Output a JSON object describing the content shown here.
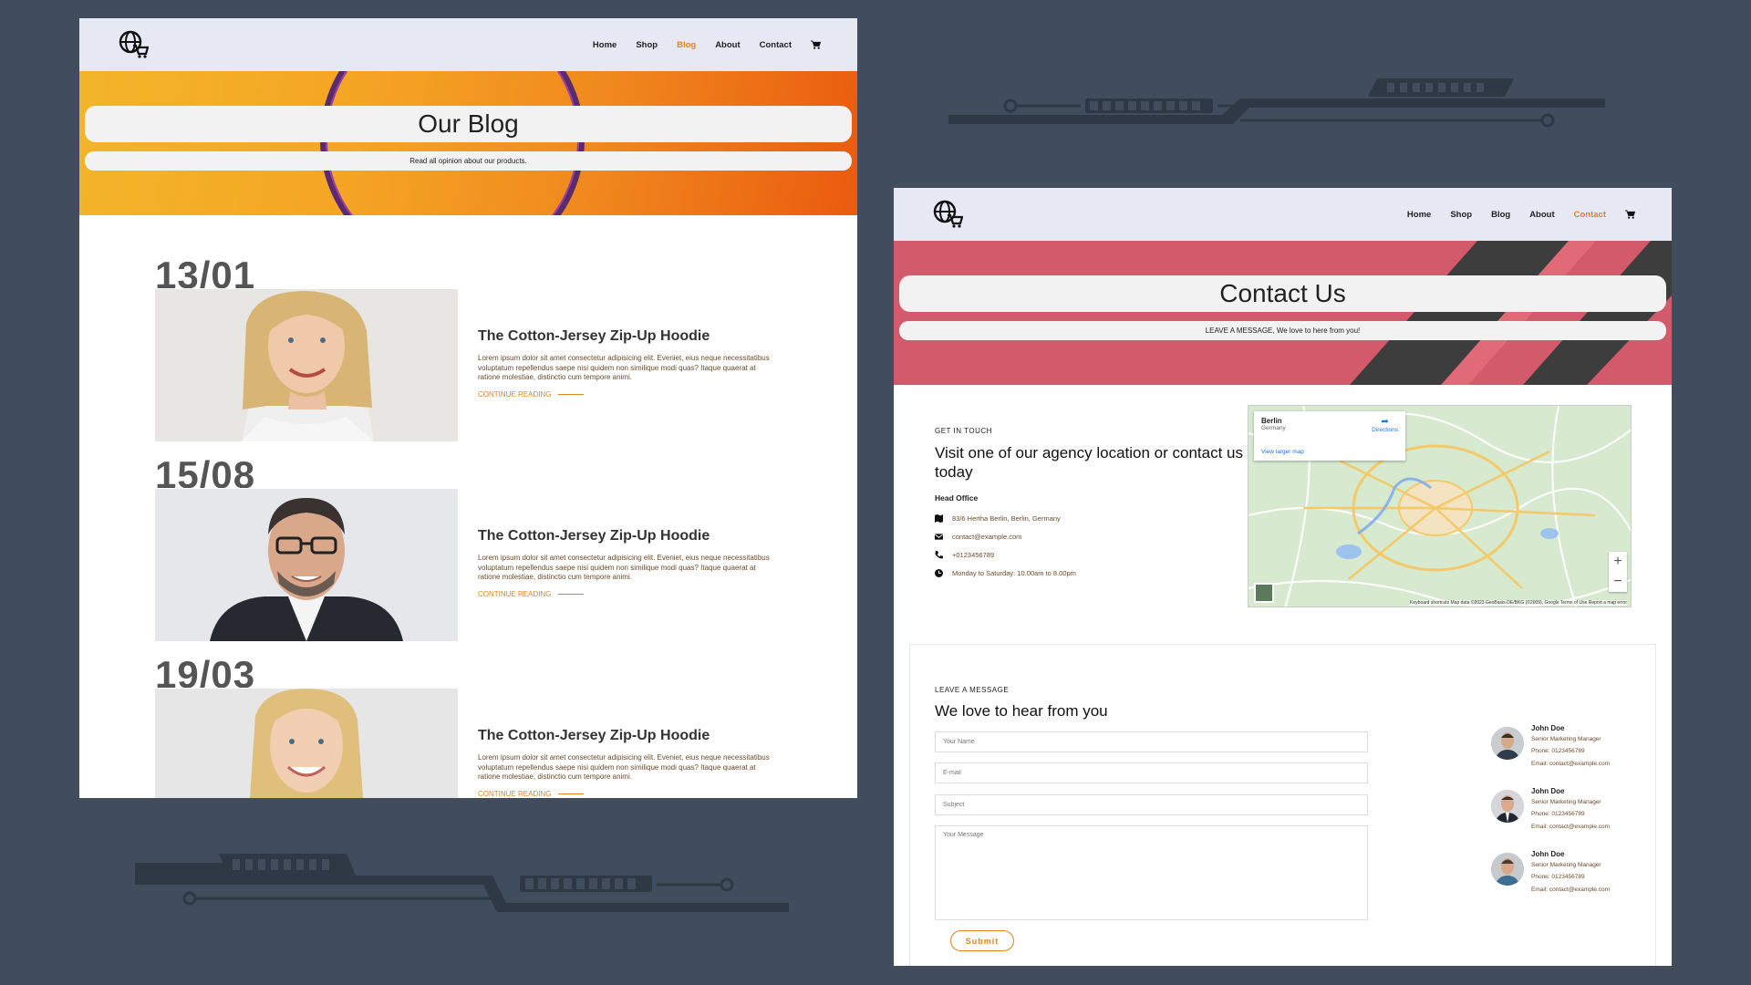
{
  "blog_page": {
    "nav": [
      "Home",
      "Shop",
      "Blog",
      "About",
      "Contact"
    ],
    "active_nav": "Blog",
    "hero_title": "Our Blog",
    "hero_subtitle": "Read all opinion about our products.",
    "posts": [
      {
        "date": "13/01",
        "title": "The Cotton-Jersey Zip-Up Hoodie",
        "text": "Lorem ipsum dolor sit amet consectetur adipisicing elit. Eveniet, eius neque necessitatibus voluptatum repellendus saepe nisi quidem non similique modi quas? Itaque quaerat at ratione molestiae, distinctio cum tempore animi.",
        "link": "CONTINUE READING"
      },
      {
        "date": "15/08",
        "title": "The Cotton-Jersey Zip-Up Hoodie",
        "text": "Lorem ipsum dolor sit amet consectetur adipisicing elit. Eveniet, eius neque necessitatibus voluptatum repellendus saepe nisi quidem non similique modi quas? Itaque quaerat at ratione molestiae, distinctio cum tempore animi.",
        "link": "CONTINUE READING"
      },
      {
        "date": "19/03",
        "title": "The Cotton-Jersey Zip-Up Hoodie",
        "text": "Lorem ipsum dolor sit amet consectetur adipisicing elit. Eveniet, eius neque necessitatibus voluptatum repellendus saepe nisi quidem non similique modi quas? Itaque quaerat at ratione molestiae, distinctio cum tempore animi.",
        "link": "CONTINUE READING"
      }
    ]
  },
  "contact_page": {
    "nav": [
      "Home",
      "Shop",
      "Blog",
      "About",
      "Contact"
    ],
    "active_nav": "Contact",
    "hero_title": "Contact Us",
    "hero_subtitle": "LEAVE A MESSAGE, We love to here from you!",
    "get_in_touch_label": "GET IN TOUCH",
    "get_in_touch_heading": "Visit one of our agency location or contact us today",
    "head_office_label": "Head Office",
    "info": [
      {
        "icon": "map-icon",
        "text": "83/6 Hertha Berlin, Berlin, Germany"
      },
      {
        "icon": "envelope-icon",
        "text": "contact@example.com"
      },
      {
        "icon": "phone-icon",
        "text": "+0123456789"
      },
      {
        "icon": "clock-icon",
        "text": "Monday to Saturday: 10.00am to 8.00pm"
      }
    ],
    "map": {
      "place": "Berlin",
      "country": "Germany",
      "directions": "Directions",
      "larger_map": "View larger map",
      "footer": "Keyboard shortcuts   Map data ©2023 GeoBasis-DE/BKG (©2009), Google   Terms of Use   Report a map error"
    },
    "leave_message_label": "LEAVE A MESSAGE",
    "leave_message_heading": "We love to hear from you",
    "form": {
      "name_placeholder": "Your Name",
      "email_placeholder": "E-mail",
      "subject_placeholder": "Subject",
      "message_placeholder": "Your Message",
      "submit_label": "Submit"
    },
    "people": [
      {
        "name": "John Doe",
        "role": "Senior Marketing Manager",
        "phone": "Phone: 0123456789",
        "email": "Email: contact@example.com"
      },
      {
        "name": "John Doe",
        "role": "Senior Marketing Manager",
        "phone": "Phone: 0123456789",
        "email": "Email: contact@example.com"
      },
      {
        "name": "John Doe",
        "role": "Senior Marketing Manager",
        "phone": "Phone: 0123456789",
        "email": "Email: contact@example.com"
      }
    ]
  },
  "colors": {
    "background": "#414d5c",
    "accent": "#e3831b",
    "navbar": "#e6e9f4",
    "contact_hero": "#d35a6a"
  }
}
